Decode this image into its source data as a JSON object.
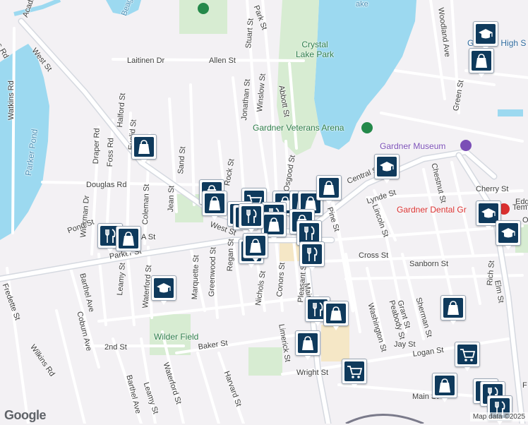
{
  "map": {
    "attribution": "Map data ©2025",
    "logo": "Google",
    "colors": {
      "background": "#f3f1f4",
      "water": "#9cd9f0",
      "park": "#d7ecd2",
      "road": "#ffffff",
      "major_road": "#d7dbe2",
      "pin_fill": "#0f3a5c",
      "poi_green": "#24894a",
      "poi_purple": "#7b4fb6",
      "poi_red": "#d93030",
      "poi_blue": "#2f6b9f"
    }
  },
  "streets": {
    "west_st": "West St",
    "west_st_2": "West St",
    "parker_st": "Parker St",
    "douglas_rd": "Douglas Rd",
    "allen_st": "Allen St",
    "laitinen_dr": "Laitinen Dr",
    "stuart_st": "Stuart St",
    "park_st": "Park St",
    "winslow_st": "Winslow St",
    "jonathan_st": "Jonathan St",
    "abbott_st": "Abbott St",
    "osgood_st": "Osgood St",
    "watkins_rd": "Watkins Rd",
    "draper_rd": "Draper Rd",
    "foss_rd": "Foss Rd",
    "halford_st": "Halford St",
    "euclid_st": "Euclid St",
    "wickman_dr": "Wickman Dr",
    "coleman_st": "Coleman St",
    "jean_st": "Jean St",
    "sand_st": "Sand St",
    "rock_st": "Rock St",
    "pond_st": "Pond St",
    "a_st": "A St",
    "marquette_st": "Marquette St",
    "greenwood_st": "Greenwood St",
    "regan_st": "Regan St",
    "nichols_st": "Nichols St",
    "conors_st": "Conors St",
    "pleasant_st": "Pleasant St",
    "main_st": "Main St",
    "pine_st": "Pine St",
    "central_st": "Central St",
    "lynde_st": "Lynde St",
    "lincoln_st": "Lincoln St",
    "chestnut_st": "Chestnut St",
    "cherry_st": "Cherry St",
    "woodland_ave": "Woodland Ave",
    "green_st": "Green St",
    "cross_st": "Cross St",
    "sanborn_st": "Sanborn St",
    "peabody_st": "Peabody St",
    "washington_st": "Washington St",
    "grant_st": "Grant St",
    "sherman_st": "Sherman St",
    "rich_st": "Rich St",
    "elm_st": "Elm St",
    "jay_st": "Jay St",
    "logan_st": "Logan St",
    "main_st_2": "Main St",
    "wright_st": "Wright St",
    "limerick_st": "Limerick St",
    "baker_st": "Baker St",
    "harvard_st": "Harvard St",
    "waterford_st": "Waterford St",
    "waterford_st_2": "Waterford St",
    "leamy_st": "Leamy St",
    "leamy_st_2": "Leamy St",
    "barthel_ave": "Barthel Ave",
    "barthel_ave_2": "Barthel Ave",
    "coburn_ave": "Coburn Ave",
    "second_st": "2nd St",
    "fredette_st": "Fredette St",
    "wilkins_rd": "Wilkins Rd",
    "acadia": "Acadi",
    "es_rd": "es Rd",
    "edg": "Edg",
    "tem": "Tem",
    "f_st": "F",
    "o_st": "O",
    "parker_pond": "Parker Pond",
    "beag": "Beag",
    "lake": "ake"
  },
  "pois": {
    "crystal_lake_park": "Crystal Lake Park",
    "veterans_arena": "Gardner Veterans Arena",
    "gardner_museum": "Gardner Museum",
    "gardner_dental": "Gardner Dental Gr",
    "gardner_high": "Gardner High S",
    "wilder_field": "Wilder Field"
  }
}
